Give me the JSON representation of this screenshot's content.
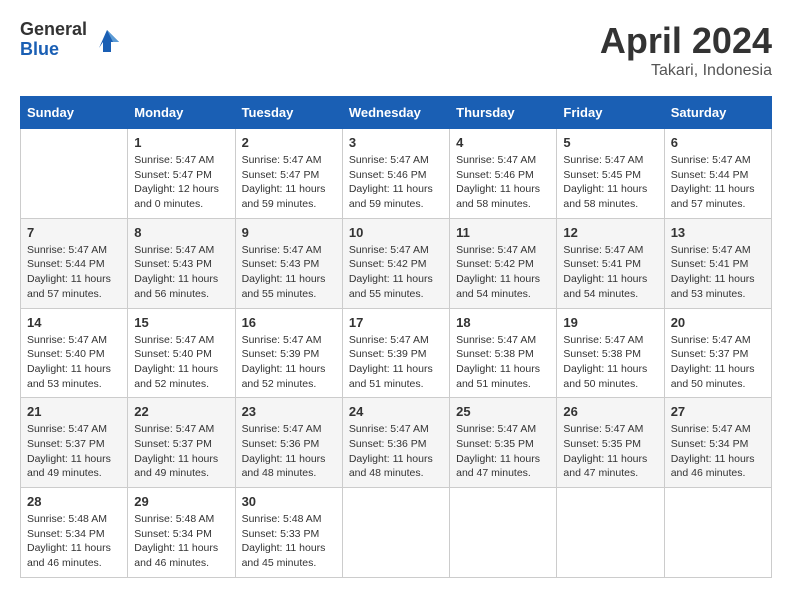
{
  "logo": {
    "general": "General",
    "blue": "Blue"
  },
  "title": "April 2024",
  "location": "Takari, Indonesia",
  "weekdays": [
    "Sunday",
    "Monday",
    "Tuesday",
    "Wednesday",
    "Thursday",
    "Friday",
    "Saturday"
  ],
  "weeks": [
    [
      {
        "day": "",
        "info": ""
      },
      {
        "day": "1",
        "info": "Sunrise: 5:47 AM\nSunset: 5:47 PM\nDaylight: 12 hours\nand 0 minutes."
      },
      {
        "day": "2",
        "info": "Sunrise: 5:47 AM\nSunset: 5:47 PM\nDaylight: 11 hours\nand 59 minutes."
      },
      {
        "day": "3",
        "info": "Sunrise: 5:47 AM\nSunset: 5:46 PM\nDaylight: 11 hours\nand 59 minutes."
      },
      {
        "day": "4",
        "info": "Sunrise: 5:47 AM\nSunset: 5:46 PM\nDaylight: 11 hours\nand 58 minutes."
      },
      {
        "day": "5",
        "info": "Sunrise: 5:47 AM\nSunset: 5:45 PM\nDaylight: 11 hours\nand 58 minutes."
      },
      {
        "day": "6",
        "info": "Sunrise: 5:47 AM\nSunset: 5:44 PM\nDaylight: 11 hours\nand 57 minutes."
      }
    ],
    [
      {
        "day": "7",
        "info": "Sunrise: 5:47 AM\nSunset: 5:44 PM\nDaylight: 11 hours\nand 57 minutes."
      },
      {
        "day": "8",
        "info": "Sunrise: 5:47 AM\nSunset: 5:43 PM\nDaylight: 11 hours\nand 56 minutes."
      },
      {
        "day": "9",
        "info": "Sunrise: 5:47 AM\nSunset: 5:43 PM\nDaylight: 11 hours\nand 55 minutes."
      },
      {
        "day": "10",
        "info": "Sunrise: 5:47 AM\nSunset: 5:42 PM\nDaylight: 11 hours\nand 55 minutes."
      },
      {
        "day": "11",
        "info": "Sunrise: 5:47 AM\nSunset: 5:42 PM\nDaylight: 11 hours\nand 54 minutes."
      },
      {
        "day": "12",
        "info": "Sunrise: 5:47 AM\nSunset: 5:41 PM\nDaylight: 11 hours\nand 54 minutes."
      },
      {
        "day": "13",
        "info": "Sunrise: 5:47 AM\nSunset: 5:41 PM\nDaylight: 11 hours\nand 53 minutes."
      }
    ],
    [
      {
        "day": "14",
        "info": "Sunrise: 5:47 AM\nSunset: 5:40 PM\nDaylight: 11 hours\nand 53 minutes."
      },
      {
        "day": "15",
        "info": "Sunrise: 5:47 AM\nSunset: 5:40 PM\nDaylight: 11 hours\nand 52 minutes."
      },
      {
        "day": "16",
        "info": "Sunrise: 5:47 AM\nSunset: 5:39 PM\nDaylight: 11 hours\nand 52 minutes."
      },
      {
        "day": "17",
        "info": "Sunrise: 5:47 AM\nSunset: 5:39 PM\nDaylight: 11 hours\nand 51 minutes."
      },
      {
        "day": "18",
        "info": "Sunrise: 5:47 AM\nSunset: 5:38 PM\nDaylight: 11 hours\nand 51 minutes."
      },
      {
        "day": "19",
        "info": "Sunrise: 5:47 AM\nSunset: 5:38 PM\nDaylight: 11 hours\nand 50 minutes."
      },
      {
        "day": "20",
        "info": "Sunrise: 5:47 AM\nSunset: 5:37 PM\nDaylight: 11 hours\nand 50 minutes."
      }
    ],
    [
      {
        "day": "21",
        "info": "Sunrise: 5:47 AM\nSunset: 5:37 PM\nDaylight: 11 hours\nand 49 minutes."
      },
      {
        "day": "22",
        "info": "Sunrise: 5:47 AM\nSunset: 5:37 PM\nDaylight: 11 hours\nand 49 minutes."
      },
      {
        "day": "23",
        "info": "Sunrise: 5:47 AM\nSunset: 5:36 PM\nDaylight: 11 hours\nand 48 minutes."
      },
      {
        "day": "24",
        "info": "Sunrise: 5:47 AM\nSunset: 5:36 PM\nDaylight: 11 hours\nand 48 minutes."
      },
      {
        "day": "25",
        "info": "Sunrise: 5:47 AM\nSunset: 5:35 PM\nDaylight: 11 hours\nand 47 minutes."
      },
      {
        "day": "26",
        "info": "Sunrise: 5:47 AM\nSunset: 5:35 PM\nDaylight: 11 hours\nand 47 minutes."
      },
      {
        "day": "27",
        "info": "Sunrise: 5:47 AM\nSunset: 5:34 PM\nDaylight: 11 hours\nand 46 minutes."
      }
    ],
    [
      {
        "day": "28",
        "info": "Sunrise: 5:48 AM\nSunset: 5:34 PM\nDaylight: 11 hours\nand 46 minutes."
      },
      {
        "day": "29",
        "info": "Sunrise: 5:48 AM\nSunset: 5:34 PM\nDaylight: 11 hours\nand 46 minutes."
      },
      {
        "day": "30",
        "info": "Sunrise: 5:48 AM\nSunset: 5:33 PM\nDaylight: 11 hours\nand 45 minutes."
      },
      {
        "day": "",
        "info": ""
      },
      {
        "day": "",
        "info": ""
      },
      {
        "day": "",
        "info": ""
      },
      {
        "day": "",
        "info": ""
      }
    ]
  ]
}
